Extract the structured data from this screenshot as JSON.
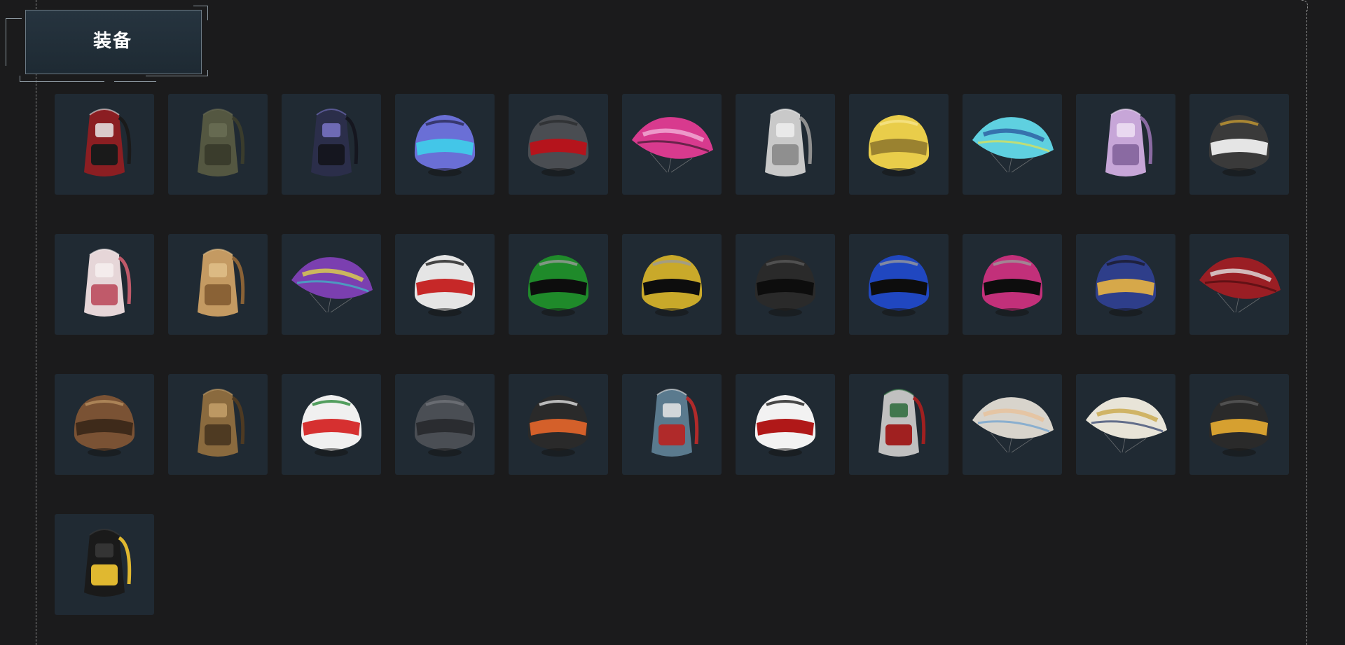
{
  "section": {
    "title": "装备"
  },
  "items": [
    {
      "type": "backpack",
      "icon": "backpack-icon",
      "colors": [
        "#8b1e22",
        "#1a1a1a",
        "#e8e8e8"
      ]
    },
    {
      "type": "backpack",
      "icon": "backpack-icon",
      "colors": [
        "#545741",
        "#3a3c2c",
        "#6a6d55"
      ]
    },
    {
      "type": "backpack",
      "icon": "backpack-icon",
      "colors": [
        "#2b2e4a",
        "#15161f",
        "#7a74c8"
      ]
    },
    {
      "type": "helmet",
      "icon": "helmet-icon",
      "colors": [
        "#6a6fd6",
        "#43c6e8",
        "#2a2b55"
      ]
    },
    {
      "type": "helmet",
      "icon": "helmet-icon",
      "colors": [
        "#4a4d52",
        "#b5141c",
        "#2b2d30"
      ]
    },
    {
      "type": "parachute",
      "icon": "parachute-icon",
      "colors": [
        "#d83a8e",
        "#3a1a2e",
        "#f2b0d8"
      ]
    },
    {
      "type": "backpack",
      "icon": "backpack-icon",
      "colors": [
        "#c9c9c9",
        "#8f8f8f",
        "#eeeeee"
      ]
    },
    {
      "type": "helmet",
      "icon": "helmet-icon",
      "colors": [
        "#e9cd4a",
        "#9a8230",
        "#f6e58a"
      ]
    },
    {
      "type": "parachute",
      "icon": "parachute-icon",
      "colors": [
        "#5fd0e0",
        "#e8e24a",
        "#2c5aa0"
      ]
    },
    {
      "type": "backpack",
      "icon": "backpack-icon",
      "colors": [
        "#c7a6d8",
        "#8a6aa2",
        "#efe0f5"
      ]
    },
    {
      "type": "helmet",
      "icon": "helmet-icon",
      "colors": [
        "#3a3a3a",
        "#e5e5e5",
        "#c59a32"
      ]
    },
    {
      "type": "backpack",
      "icon": "backpack-icon",
      "colors": [
        "#e6d6d8",
        "#c05a6a",
        "#f6f0f0"
      ]
    },
    {
      "type": "backpack",
      "icon": "backpack-icon",
      "colors": [
        "#c49a62",
        "#8a6236",
        "#e0c08a"
      ]
    },
    {
      "type": "parachute",
      "icon": "parachute-icon",
      "colors": [
        "#7b3fb0",
        "#3ac0c8",
        "#e0d44a"
      ]
    },
    {
      "type": "helmet",
      "icon": "helmet-icon",
      "colors": [
        "#e5e5e5",
        "#c62828",
        "#1a1a1a"
      ]
    },
    {
      "type": "helmet",
      "icon": "helmet-icon",
      "colors": [
        "#1f8a2a",
        "#0d0d0d",
        "#9a9a9a"
      ]
    },
    {
      "type": "helmet",
      "icon": "helmet-icon",
      "colors": [
        "#c9a92a",
        "#0d0d0d",
        "#9a9a9a"
      ]
    },
    {
      "type": "helmet",
      "icon": "helmet-icon",
      "colors": [
        "#2a2a2a",
        "#0d0d0d",
        "#5a5a5a"
      ]
    },
    {
      "type": "helmet",
      "icon": "helmet-icon",
      "colors": [
        "#2047c0",
        "#0d0d0d",
        "#9a9a9a"
      ]
    },
    {
      "type": "helmet",
      "icon": "helmet-icon",
      "colors": [
        "#c2307a",
        "#0d0d0d",
        "#9a9a9a"
      ]
    },
    {
      "type": "helmet",
      "icon": "helmet-icon",
      "colors": [
        "#2e3e8a",
        "#d6a84a",
        "#1a1a2a"
      ]
    },
    {
      "type": "parachute",
      "icon": "parachute-icon",
      "colors": [
        "#9a1e24",
        "#4a0c10",
        "#e0e0e0"
      ]
    },
    {
      "type": "helmet",
      "icon": "helmet-icon",
      "colors": [
        "#7a5234",
        "#3e2a1a",
        "#b89060"
      ]
    },
    {
      "type": "backpack",
      "icon": "backpack-icon",
      "colors": [
        "#8a6a3e",
        "#4e3a22",
        "#c4a06a"
      ]
    },
    {
      "type": "helmet",
      "icon": "helmet-icon",
      "colors": [
        "#f0f0f0",
        "#d63030",
        "#2a8a3a"
      ]
    },
    {
      "type": "helmet",
      "icon": "helmet-icon",
      "colors": [
        "#4a4e54",
        "#2a2c30",
        "#707479"
      ]
    },
    {
      "type": "helmet",
      "icon": "helmet-icon",
      "colors": [
        "#2a2a2a",
        "#d4602a",
        "#e0e0e0"
      ]
    },
    {
      "type": "backpack",
      "icon": "backpack-icon",
      "colors": [
        "#5a7a8e",
        "#b02a2a",
        "#e8e8e8"
      ]
    },
    {
      "type": "helmet",
      "icon": "helmet-icon",
      "colors": [
        "#f2f2f2",
        "#b01818",
        "#1a1a1a"
      ]
    },
    {
      "type": "backpack",
      "icon": "backpack-icon",
      "colors": [
        "#c0c0c0",
        "#a02020",
        "#2a6a3a"
      ]
    },
    {
      "type": "parachute",
      "icon": "parachute-icon",
      "colors": [
        "#d8d4cc",
        "#6aa0d0",
        "#e8c09a"
      ]
    },
    {
      "type": "parachute",
      "icon": "parachute-icon",
      "colors": [
        "#e8e4d8",
        "#2a3a6a",
        "#c9a84a"
      ]
    },
    {
      "type": "helmet",
      "icon": "helmet-icon",
      "colors": [
        "#2a2a2a",
        "#d6a030",
        "#5a5a5a"
      ]
    },
    {
      "type": "backpack",
      "icon": "backpack-icon",
      "colors": [
        "#1a1a1a",
        "#e0b830",
        "#3a3a3a"
      ]
    }
  ]
}
